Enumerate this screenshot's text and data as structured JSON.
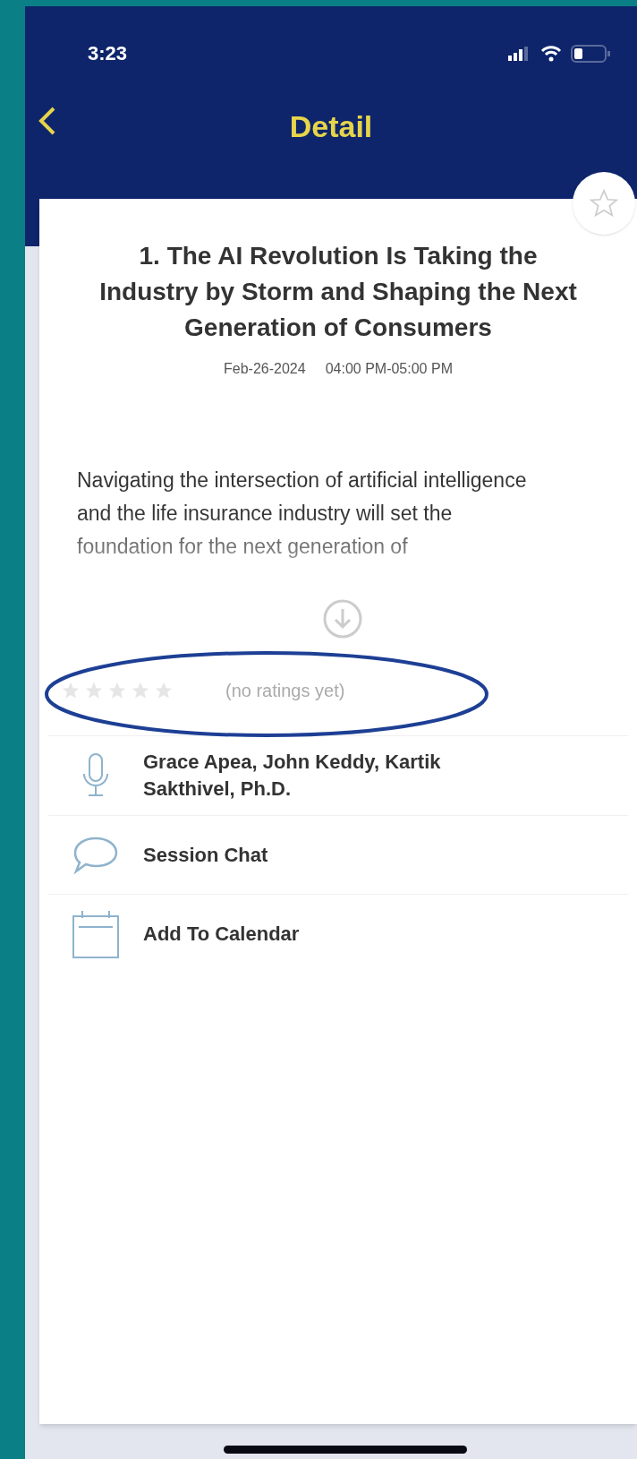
{
  "status_bar": {
    "time": "3:23"
  },
  "nav": {
    "title": "Detail"
  },
  "session": {
    "favorite": false,
    "title": "1. The AI Revolution Is Taking the Industry by Storm and Shaping the Next Generation of Consumers",
    "date": "Feb-26-2024",
    "time": "04:00 PM-05:00 PM",
    "description": "Navigating the intersection of artificial intelligence and the life insurance industry will set the foundation for the next generation of"
  },
  "rating": {
    "stars": 0,
    "label": "(no ratings yet)"
  },
  "actions": [
    {
      "kind": "speakers",
      "label": "Grace Apea, John Keddy, Kartik Sakthivel, Ph.D."
    },
    {
      "kind": "chat",
      "label": "Session Chat"
    },
    {
      "kind": "calendar",
      "label": "Add To Calendar"
    }
  ]
}
